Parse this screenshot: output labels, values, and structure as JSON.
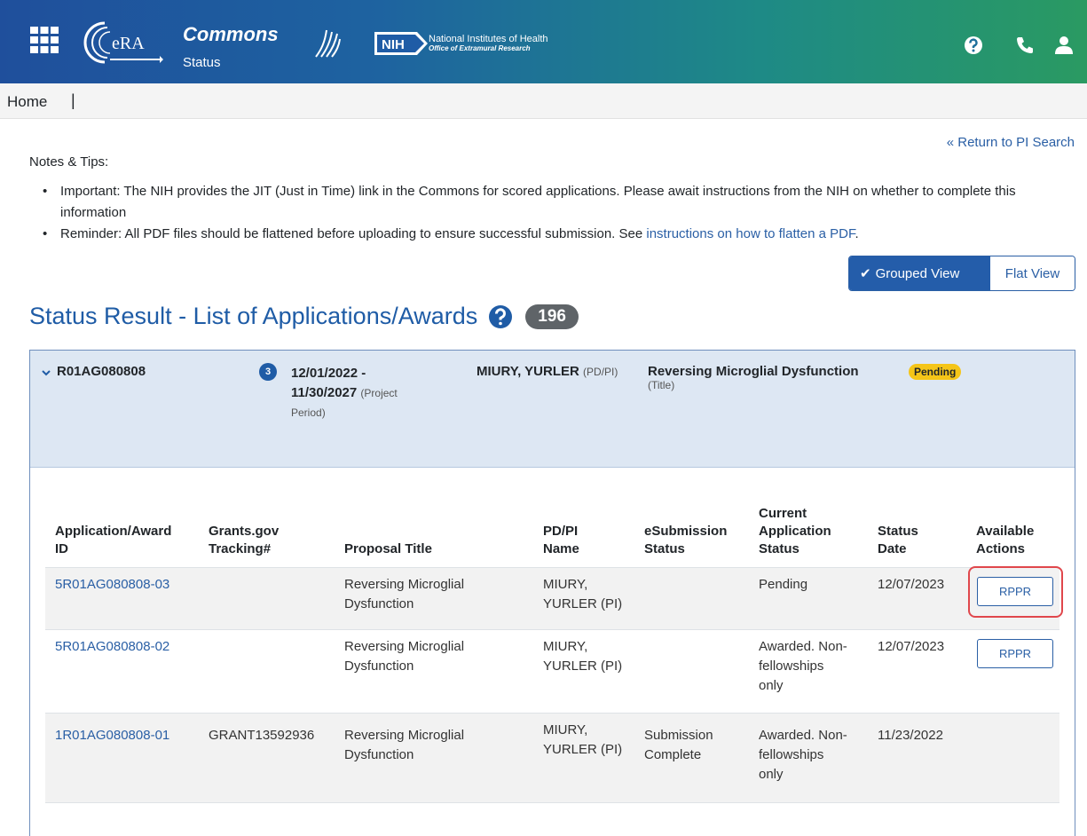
{
  "header": {
    "app_name": "Commons",
    "app_sub": "Status",
    "era_logo_text": "eRA",
    "nih_badge": "NIH",
    "nih_line1": "National Institutes of Health",
    "nih_line2": "Office of Extramural Research",
    "colors": {
      "gradient_start": "#1f4f9c",
      "gradient_end": "#2a9a62"
    },
    "icons": [
      "apps-grid-icon",
      "help-icon",
      "phone-icon",
      "user-icon"
    ]
  },
  "breadcrumb": {
    "home": "Home",
    "separator": "|"
  },
  "return_link": "« Return to PI Search",
  "notes": {
    "title": "Notes & Tips:",
    "items": [
      {
        "text": "Important: The NIH provides the JIT (Just in Time) link in the Commons for scored applications. Please await instructions from the NIH on whether to complete this information"
      },
      {
        "text": "Reminder: All PDF files should be flattened before uploading to ensure successful submission. See ",
        "link": "instructions on how to flatten a PDF",
        "after": "."
      }
    ]
  },
  "view_toggle": {
    "grouped": "Grouped View",
    "flat": "Flat View",
    "active": "grouped",
    "check": "✔"
  },
  "heading": {
    "title": "Status Result - List of Applications/Awards",
    "count": "196"
  },
  "group": {
    "id": "R01AG080808",
    "count": "3",
    "period_line1": "12/01/2022 -",
    "period_line2": "11/30/2027",
    "period_label1": "(Project",
    "period_label2": "Period)",
    "pi": "MIURY, YURLER",
    "pi_label": "(PD/PI)",
    "title": "Reversing Microglial Dysfunction",
    "title_label": "(Title)",
    "status": "Pending",
    "status_color": "#f5c518"
  },
  "table": {
    "headers": [
      [
        "Application/Award",
        "ID"
      ],
      [
        "Grants.gov",
        "Tracking#"
      ],
      [
        "Proposal Title"
      ],
      [
        "PD/PI",
        "Name"
      ],
      [
        "eSubmission",
        "Status"
      ],
      [
        "Current",
        "Application",
        "Status"
      ],
      [
        "Status",
        "Date"
      ],
      [
        "Available",
        "Actions"
      ]
    ],
    "rows": [
      {
        "id": "5R01AG080808-03",
        "tracking": "",
        "title1": "Reversing Microglial",
        "title2": "Dysfunction",
        "pi1": "MIURY,",
        "pi2": "YURLER (PI)",
        "esub1": "",
        "esub2": "",
        "status1": "Pending",
        "status2": "",
        "status3": "",
        "date": "12/07/2023",
        "action": "RPPR"
      },
      {
        "id": "5R01AG080808-02",
        "tracking": "",
        "title1": "Reversing Microglial",
        "title2": "Dysfunction",
        "pi1": "MIURY,",
        "pi2": "YURLER (PI)",
        "esub1": "",
        "esub2": "",
        "status1": "Awarded. Non-",
        "status2": "fellowships",
        "status3": "only",
        "date": "12/07/2023",
        "action": "RPPR"
      },
      {
        "id": "1R01AG080808-01",
        "tracking": "GRANT13592936",
        "title1": "Reversing Microglial",
        "title2": "Dysfunction",
        "pi1": "MIURY,",
        "pi2": "YURLER (PI)",
        "esub1": "Submission",
        "esub2": "Complete",
        "status1": "Awarded. Non-",
        "status2": "fellowships",
        "status3": "only",
        "date": "11/23/2022",
        "action": ""
      }
    ]
  }
}
